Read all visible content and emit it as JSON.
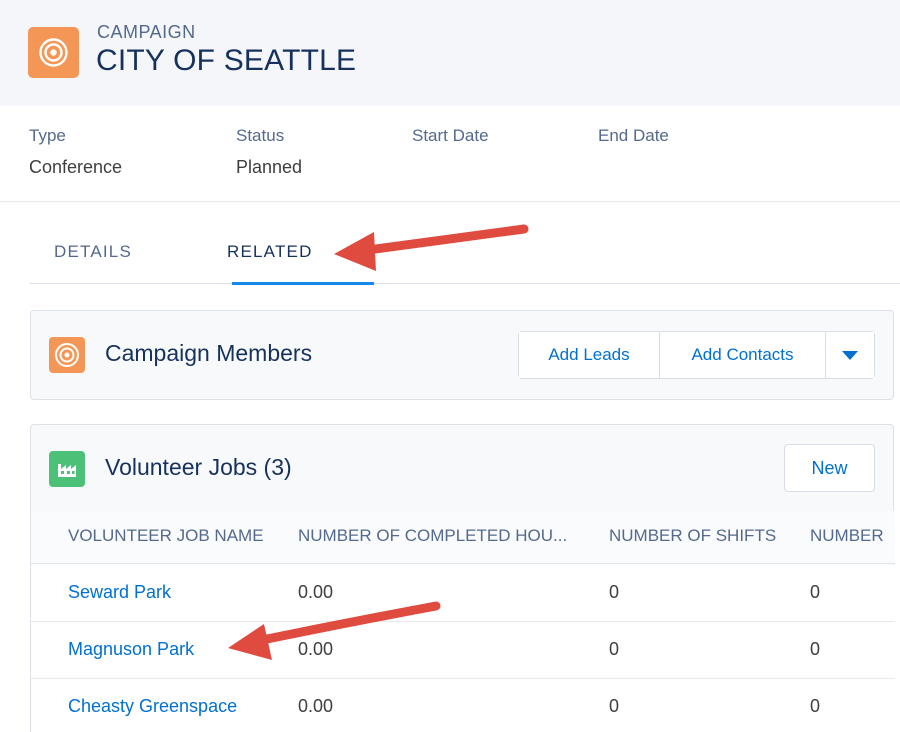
{
  "header": {
    "object_label": "CAMPAIGN",
    "title": "CITY OF SEATTLE",
    "icon": "campaign-target-icon",
    "icon_color": "#f49756"
  },
  "fields": [
    {
      "label": "Type",
      "value": "Conference"
    },
    {
      "label": "Status",
      "value": "Planned"
    },
    {
      "label": "Start Date",
      "value": ""
    },
    {
      "label": "End Date",
      "value": ""
    }
  ],
  "tabs": [
    {
      "label": "DETAILS",
      "active": false
    },
    {
      "label": "RELATED",
      "active": true
    }
  ],
  "campaign_members": {
    "title": "Campaign Members",
    "icon": "campaign-target-icon",
    "buttons": {
      "add_leads": "Add Leads",
      "add_contacts": "Add Contacts"
    },
    "dropdown_icon": "chevron-down-icon"
  },
  "volunteer_jobs": {
    "title": "Volunteer Jobs (3)",
    "icon": "volunteer-job-icon",
    "icon_color": "#4bc076",
    "new_button": "New",
    "columns": [
      "VOLUNTEER JOB NAME",
      "NUMBER OF COMPLETED HOU...",
      "NUMBER OF SHIFTS",
      "NUMBER"
    ],
    "rows": [
      {
        "name": "Seward Park",
        "completed_hours": "0.00",
        "shifts": "0",
        "number": "0"
      },
      {
        "name": "Magnuson Park",
        "completed_hours": "0.00",
        "shifts": "0",
        "number": "0"
      },
      {
        "name": "Cheasty Greenspace",
        "completed_hours": "0.00",
        "shifts": "0",
        "number": "0"
      }
    ]
  },
  "colors": {
    "accent": "#0070d2",
    "tab_underline": "#1589ee",
    "annotation_arrow": "#e04b3f"
  }
}
